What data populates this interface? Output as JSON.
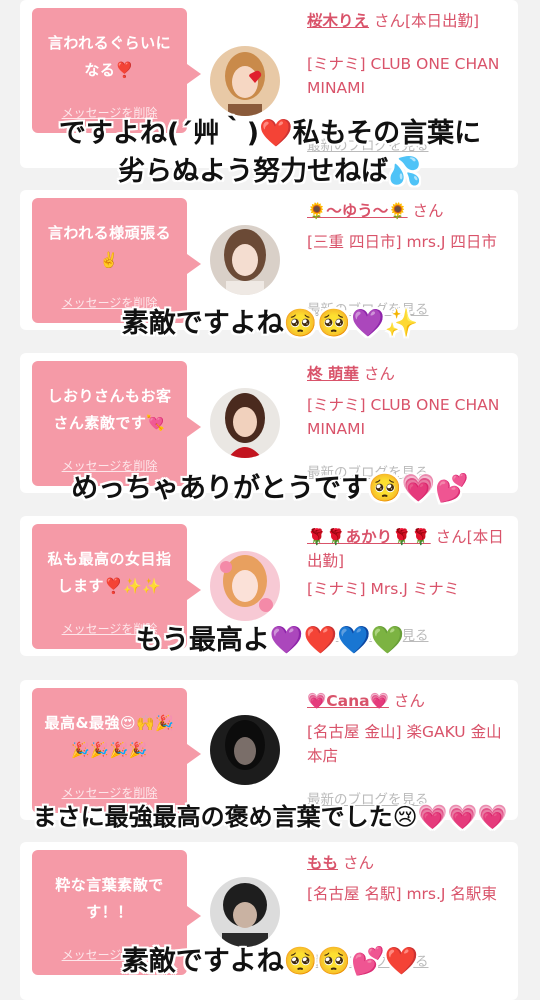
{
  "delete_label": "メッセージを削除",
  "blog_label": "最新のブログを見る",
  "san": "さん",
  "cards": [
    {
      "message": "言われるぐらいになる❣️",
      "name": "桜木りえ",
      "badge": "[本日出勤]",
      "shop": "[ミナミ] CLUB ONE CHAN MINAMI",
      "overlay": [
        "ですよね(´艸｀)❤️私もその言葉に",
        "劣らぬよう努力せねば💦"
      ]
    },
    {
      "message": "言われる様頑張る✌️",
      "name": "🌻〜ゆう〜🌻",
      "badge": "",
      "shop": "[三重 四日市] mrs.J 四日市",
      "overlay": [
        "素敵ですよね🥺🥺💜✨"
      ]
    },
    {
      "message": "しおりさんもお客さん素敵です💘",
      "name": "柊 萌華",
      "badge": "",
      "shop": "[ミナミ] CLUB ONE CHAN MINAMI",
      "overlay": [
        "めっちゃありがとうです🥺💗💕"
      ]
    },
    {
      "message": "私も最高の女目指します❣️✨✨",
      "name": "🌹🌹あかり🌹🌹",
      "badge": "[本日出勤]",
      "shop": "[ミナミ] Mrs.J ミナミ",
      "overlay": [
        "もう最高よ💜❤️💙💚"
      ]
    },
    {
      "message": "最高&最強😍🙌🎉🎉🎉🎉🎉",
      "name": "💗Cana💗",
      "badge": "",
      "shop": "[名古屋 金山] 楽GAKU 金山本店",
      "overlay": [
        "まさに最強最高の褒め言葉でした😢💗💗💗"
      ]
    },
    {
      "message": "粋な言葉素敵です！！",
      "name": "もも",
      "badge": "",
      "shop": "[名古屋 名駅] mrs.J 名駅東",
      "overlay": [
        "素敵ですよね🥺🥺💕❤️"
      ]
    }
  ],
  "colors": {
    "bubble": "#f59aa7",
    "accent": "#d9536a",
    "background": "#f2f2f2"
  }
}
